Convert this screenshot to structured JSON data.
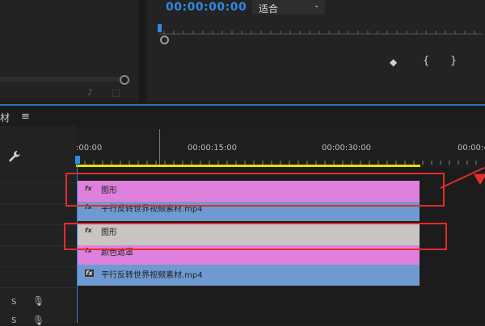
{
  "monitor": {
    "timecode": "00:00:00:00",
    "zoom": "适合",
    "buttons": {
      "marker": "◆",
      "in_point": "{",
      "out_point": "}"
    }
  },
  "left_panel": {
    "icons": "♪ ⬚"
  },
  "timeline": {
    "title_fragment": "材",
    "menu_icon": "≡",
    "wrench_icon": "🔧",
    "ruler": [
      ":00:00",
      "00:00:15:00",
      "00:00:30:00",
      "00:00:4"
    ],
    "tracks": {
      "s_label": "S",
      "mic_icon": "🎙"
    },
    "clips": [
      {
        "fx": "fx",
        "label": "图形"
      },
      {
        "fx": "fx",
        "label": "平行反转世界视频素材.mp4"
      },
      {
        "fx": "fx",
        "label": "图形"
      },
      {
        "fx": "fx",
        "label": "颜色遮罩"
      },
      {
        "fx": "fx",
        "label": "平行反转世界视频素材.mp4"
      }
    ]
  },
  "colors": {
    "accent_blue": "#2f8ae0",
    "pink_clip": "#e080dd",
    "blue_clip": "#6e9ad1",
    "gray_clip": "#c8c5c3",
    "annotation_red": "#e32b2b",
    "work_area_yellow": "#e7e000"
  }
}
